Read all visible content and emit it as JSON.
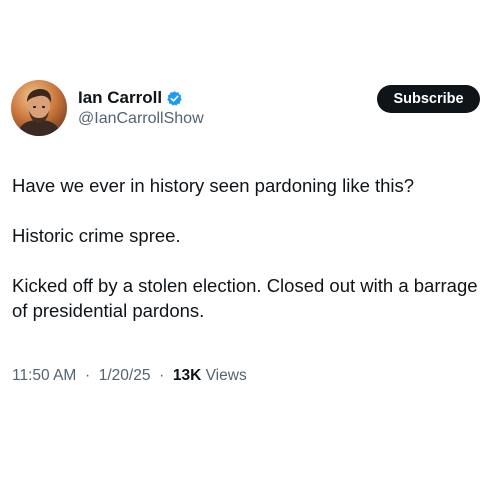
{
  "author": {
    "display_name": "Ian Carroll",
    "handle": "@IanCarrollShow",
    "avatar_icon": "profile-photo",
    "verified_icon": "verified-badge-icon",
    "verified_color": "#1d9bf0"
  },
  "subscribe_label": "Subscribe",
  "tweet": {
    "paragraphs": [
      "Have we ever in history seen pardoning like this?",
      "Historic crime spree.",
      "Kicked off by a stolen election. Closed out with a barrage of presidential pardons."
    ]
  },
  "meta": {
    "time": "11:50 AM",
    "separator": "·",
    "date": "1/20/25",
    "views_count": "13K",
    "views_label": "Views"
  },
  "colors": {
    "text_primary": "#0f1419",
    "text_secondary": "#536471",
    "button_bg": "#0f1419",
    "button_text": "#ffffff"
  }
}
